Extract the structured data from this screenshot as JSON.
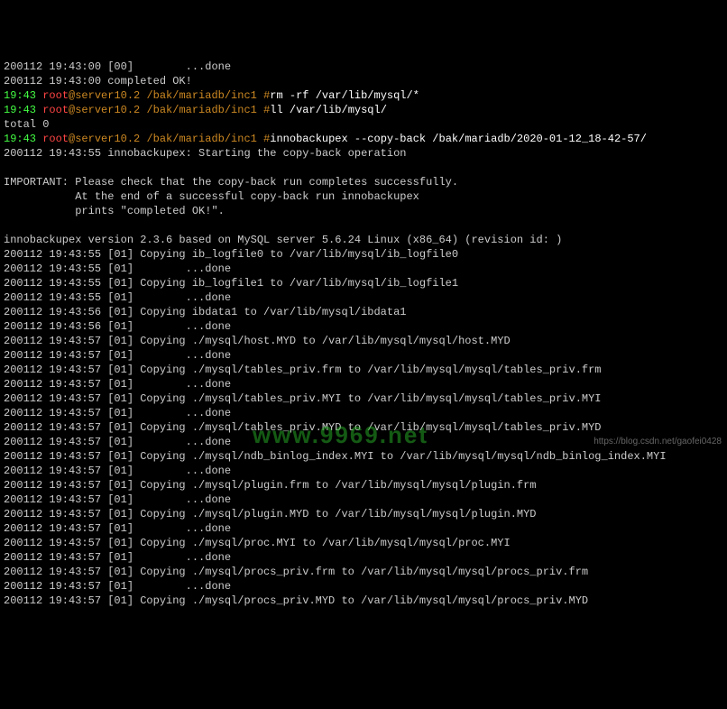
{
  "lines": [
    {
      "segments": [
        {
          "t": "200112 19:43:00 [00]        ...done",
          "c": "grey"
        }
      ]
    },
    {
      "segments": [
        {
          "t": "200112 19:43:00 completed OK!",
          "c": "grey"
        }
      ]
    },
    {
      "segments": [
        {
          "t": "19:43",
          "c": "green"
        },
        {
          "t": " ",
          "c": "grey"
        },
        {
          "t": "root",
          "c": "red"
        },
        {
          "t": "@server10.2 /bak/mariadb/inc1 #",
          "c": "gold"
        },
        {
          "t": "rm -rf /var/lib/mysql/*",
          "c": "white"
        }
      ]
    },
    {
      "segments": [
        {
          "t": "19:43",
          "c": "green"
        },
        {
          "t": " ",
          "c": "grey"
        },
        {
          "t": "root",
          "c": "red"
        },
        {
          "t": "@server10.2 /bak/mariadb/inc1 #",
          "c": "gold"
        },
        {
          "t": "ll /var/lib/mysql/",
          "c": "white"
        }
      ]
    },
    {
      "segments": [
        {
          "t": "total 0",
          "c": "grey"
        }
      ]
    },
    {
      "segments": [
        {
          "t": "19:43",
          "c": "green"
        },
        {
          "t": " ",
          "c": "grey"
        },
        {
          "t": "root",
          "c": "red"
        },
        {
          "t": "@server10.2 /bak/mariadb/inc1 #",
          "c": "gold"
        },
        {
          "t": "innobackupex --copy-back /bak/mariadb/2020-01-12_18-42-57/",
          "c": "white"
        }
      ]
    },
    {
      "segments": [
        {
          "t": "200112 19:43:55 innobackupex: Starting the copy-back operation",
          "c": "grey"
        }
      ]
    },
    {
      "segments": [
        {
          "t": "",
          "c": "grey"
        }
      ]
    },
    {
      "segments": [
        {
          "t": "IMPORTANT: Please check that the copy-back run completes successfully.",
          "c": "grey"
        }
      ]
    },
    {
      "segments": [
        {
          "t": "           At the end of a successful copy-back run innobackupex",
          "c": "grey"
        }
      ]
    },
    {
      "segments": [
        {
          "t": "           prints \"completed OK!\".",
          "c": "grey"
        }
      ]
    },
    {
      "segments": [
        {
          "t": "",
          "c": "grey"
        }
      ]
    },
    {
      "segments": [
        {
          "t": "innobackupex version 2.3.6 based on MySQL server 5.6.24 Linux (x86_64) (revision id: )",
          "c": "grey"
        }
      ]
    },
    {
      "segments": [
        {
          "t": "200112 19:43:55 [01] Copying ib_logfile0 to /var/lib/mysql/ib_logfile0",
          "c": "grey"
        }
      ]
    },
    {
      "segments": [
        {
          "t": "200112 19:43:55 [01]        ...done",
          "c": "grey"
        }
      ]
    },
    {
      "segments": [
        {
          "t": "200112 19:43:55 [01] Copying ib_logfile1 to /var/lib/mysql/ib_logfile1",
          "c": "grey"
        }
      ]
    },
    {
      "segments": [
        {
          "t": "200112 19:43:55 [01]        ...done",
          "c": "grey"
        }
      ]
    },
    {
      "segments": [
        {
          "t": "200112 19:43:56 [01] Copying ibdata1 to /var/lib/mysql/ibdata1",
          "c": "grey"
        }
      ]
    },
    {
      "segments": [
        {
          "t": "200112 19:43:56 [01]        ...done",
          "c": "grey"
        }
      ]
    },
    {
      "segments": [
        {
          "t": "200112 19:43:57 [01] Copying ./mysql/host.MYD to /var/lib/mysql/mysql/host.MYD",
          "c": "grey"
        }
      ]
    },
    {
      "segments": [
        {
          "t": "200112 19:43:57 [01]        ...done",
          "c": "grey"
        }
      ]
    },
    {
      "segments": [
        {
          "t": "200112 19:43:57 [01] Copying ./mysql/tables_priv.frm to /var/lib/mysql/mysql/tables_priv.frm",
          "c": "grey"
        }
      ]
    },
    {
      "segments": [
        {
          "t": "200112 19:43:57 [01]        ...done",
          "c": "grey"
        }
      ]
    },
    {
      "segments": [
        {
          "t": "200112 19:43:57 [01] Copying ./mysql/tables_priv.MYI to /var/lib/mysql/mysql/tables_priv.MYI",
          "c": "grey"
        }
      ]
    },
    {
      "segments": [
        {
          "t": "200112 19:43:57 [01]        ...done",
          "c": "grey"
        }
      ]
    },
    {
      "segments": [
        {
          "t": "200112 19:43:57 [01] Copying ./mysql/tables_priv.MYD to /var/lib/mysql/mysql/tables_priv.MYD",
          "c": "grey"
        }
      ]
    },
    {
      "segments": [
        {
          "t": "200112 19:43:57 [01]        ...done",
          "c": "grey"
        }
      ]
    },
    {
      "segments": [
        {
          "t": "200112 19:43:57 [01] Copying ./mysql/ndb_binlog_index.MYI to /var/lib/mysql/mysql/ndb_binlog_index.MYI",
          "c": "grey"
        }
      ]
    },
    {
      "segments": [
        {
          "t": "200112 19:43:57 [01]        ...done",
          "c": "grey"
        }
      ]
    },
    {
      "segments": [
        {
          "t": "200112 19:43:57 [01] Copying ./mysql/plugin.frm to /var/lib/mysql/mysql/plugin.frm",
          "c": "grey"
        }
      ]
    },
    {
      "segments": [
        {
          "t": "200112 19:43:57 [01]        ...done",
          "c": "grey"
        }
      ]
    },
    {
      "segments": [
        {
          "t": "200112 19:43:57 [01] Copying ./mysql/plugin.MYD to /var/lib/mysql/mysql/plugin.MYD",
          "c": "grey"
        }
      ]
    },
    {
      "segments": [
        {
          "t": "200112 19:43:57 [01]        ...done",
          "c": "grey"
        }
      ]
    },
    {
      "segments": [
        {
          "t": "200112 19:43:57 [01] Copying ./mysql/proc.MYI to /var/lib/mysql/mysql/proc.MYI",
          "c": "grey"
        }
      ]
    },
    {
      "segments": [
        {
          "t": "200112 19:43:57 [01]        ...done",
          "c": "grey"
        }
      ]
    },
    {
      "segments": [
        {
          "t": "200112 19:43:57 [01] Copying ./mysql/procs_priv.frm to /var/lib/mysql/mysql/procs_priv.frm",
          "c": "grey"
        }
      ]
    },
    {
      "segments": [
        {
          "t": "200112 19:43:57 [01]        ...done",
          "c": "grey"
        }
      ]
    },
    {
      "segments": [
        {
          "t": "200112 19:43:57 [01] Copying ./mysql/procs_priv.MYD to /var/lib/mysql/mysql/procs_priv.MYD",
          "c": "grey"
        }
      ]
    }
  ],
  "watermark1": "www.9969.net",
  "watermark2": "https://blog.csdn.net/gaofei0428"
}
